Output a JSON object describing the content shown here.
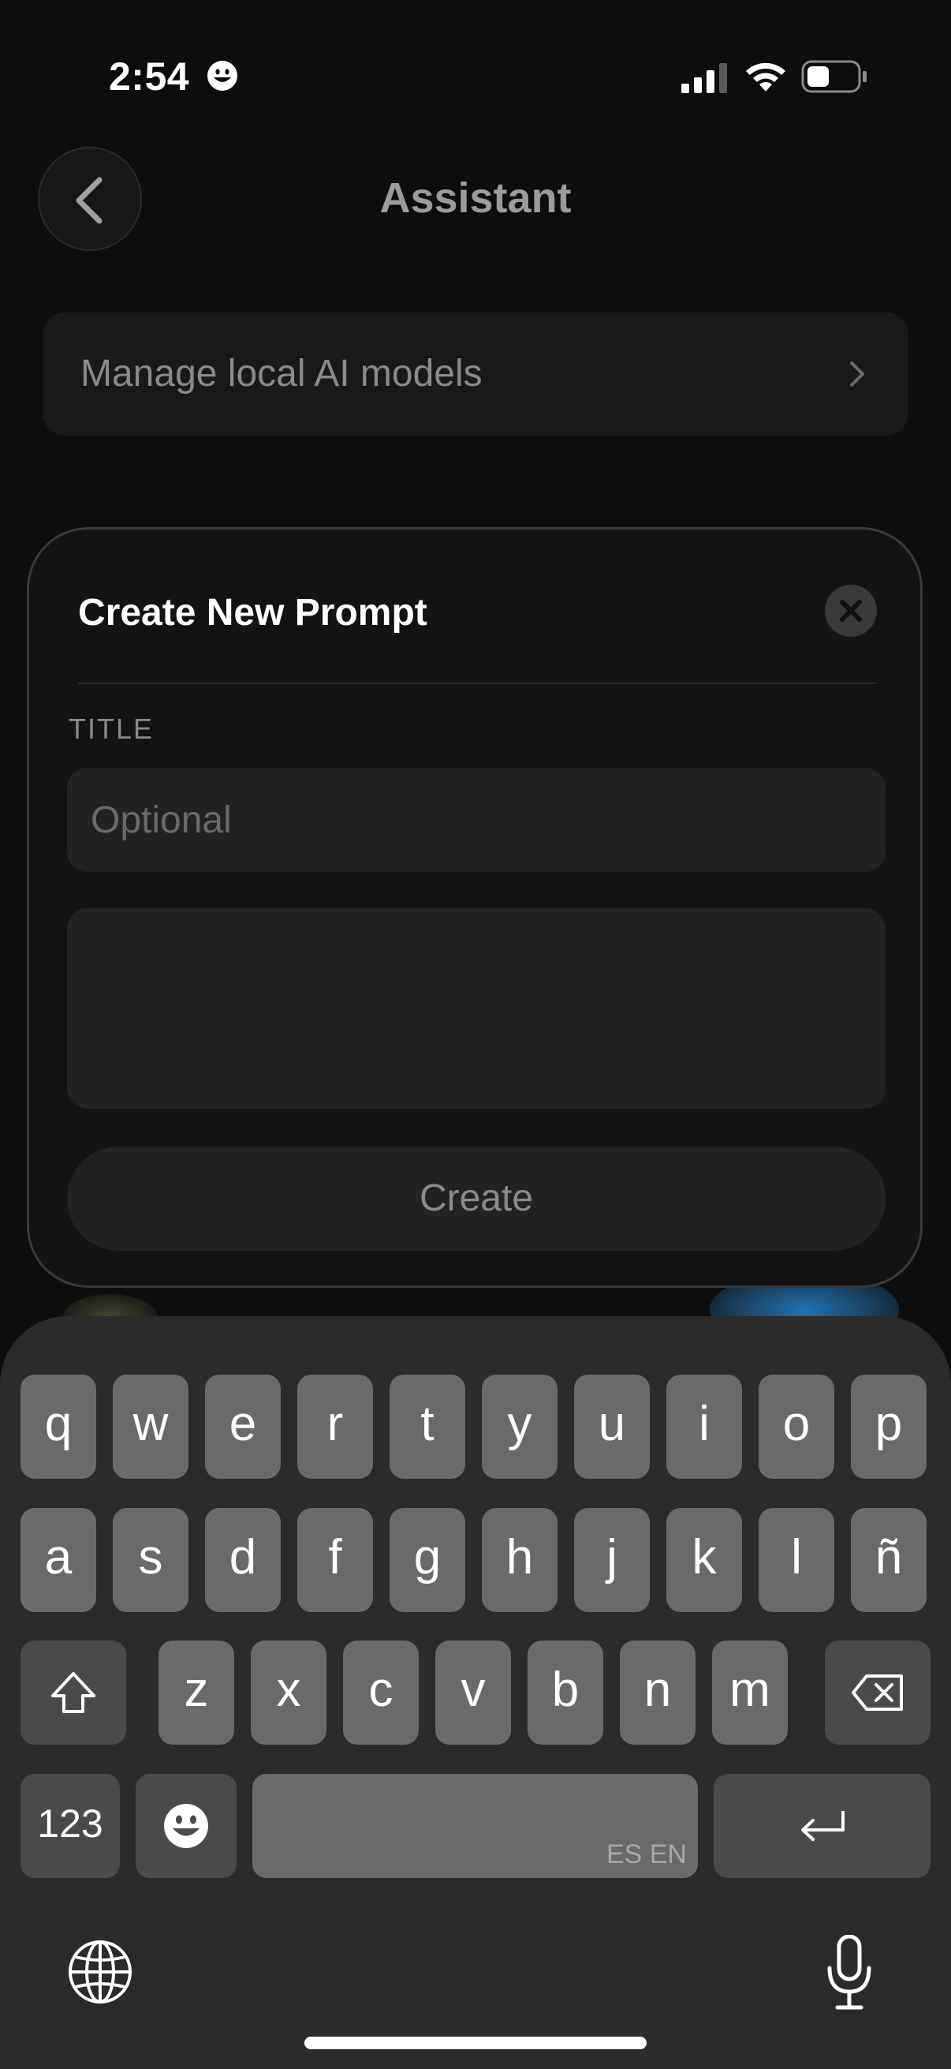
{
  "status_bar": {
    "time": "2:54",
    "battery_level": 0.45
  },
  "header": {
    "title": "Assistant"
  },
  "manage_row": {
    "label": "Manage local AI models"
  },
  "modal": {
    "title": "Create New Prompt",
    "field_label": "TITLE",
    "title_placeholder": "Optional",
    "title_value": "",
    "body_value": "",
    "create_label": "Create"
  },
  "keyboard": {
    "row1": [
      "q",
      "w",
      "e",
      "r",
      "t",
      "y",
      "u",
      "i",
      "o",
      "p"
    ],
    "row2": [
      "a",
      "s",
      "d",
      "f",
      "g",
      "h",
      "j",
      "k",
      "l",
      "ñ"
    ],
    "row3": [
      "z",
      "x",
      "c",
      "v",
      "b",
      "n",
      "m"
    ],
    "numbers_label": "123",
    "language_tag": "ES EN"
  },
  "colors": {
    "background": "#0d0d0d",
    "modal": "#131313",
    "field": "#222222",
    "keyboard": "#2b2b2b",
    "key": "#6a6a6a",
    "key_dark": "#4a4a4a"
  }
}
